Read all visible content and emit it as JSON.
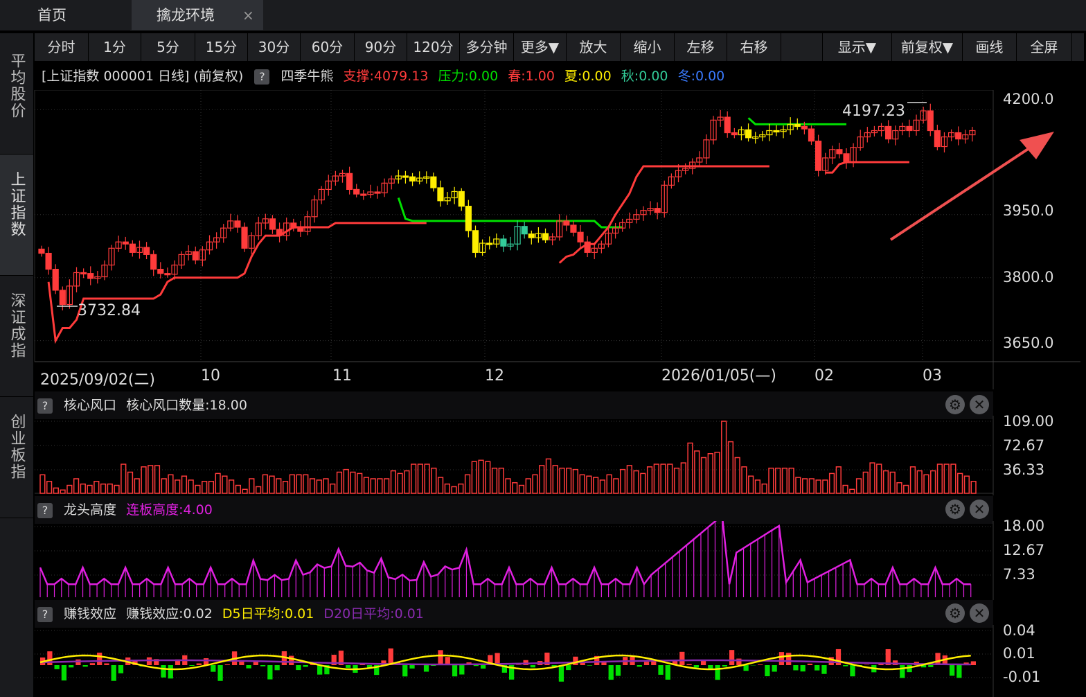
{
  "tabs": {
    "home": "首页",
    "active": "擒龙环境",
    "close": "×"
  },
  "sidebar": [
    "平均股价",
    "上证指数",
    "深证成指",
    "创业板指"
  ],
  "toolbar": [
    "分时",
    "1分",
    "5分",
    "15分",
    "30分",
    "60分",
    "90分",
    "120分",
    "多分钟",
    "更多▼",
    "放大",
    "缩小",
    "左移",
    "右移",
    "",
    "显示▼",
    "前复权▼",
    "画线",
    "全屏"
  ],
  "info": {
    "title": "[上证指数 000001 日线] (前复权)",
    "help": "?",
    "indicator": "四季牛熊",
    "support_label": "支撑:4079.13",
    "pressure_label": "压力:0.00",
    "spring_label": "春:1.00",
    "summer_label": "夏:0.00",
    "autumn_label": "秋:0.00",
    "winter_label": "冬:0.00"
  },
  "main_chart": {
    "high_label": "4197.23",
    "low_label": "3732.84",
    "y_ticks": [
      "4200.0",
      "3950.0",
      "3800.0",
      "3650.0"
    ],
    "x_ticks": [
      "2025/09/02(二)",
      "10",
      "11",
      "12",
      "2026/01/05(—)",
      "02",
      "03"
    ]
  },
  "panel1": {
    "help": "?",
    "name": "核心风口",
    "value_label": "核心风口数量:18.00",
    "y_ticks": [
      "109.00",
      "72.67",
      "36.33"
    ]
  },
  "panel2": {
    "help": "?",
    "name": "龙头高度",
    "value_label": "连板高度:4.00",
    "y_ticks": [
      "18.00",
      "12.67",
      "7.33"
    ]
  },
  "panel3": {
    "help": "?",
    "name": "赚钱效应",
    "value_label": "赚钱效应:0.02",
    "d5_label": "D5日平均:0.01",
    "d20_label": "D20日平均:0.01",
    "y_ticks": [
      "0.04",
      "0.01",
      "-0.01"
    ]
  },
  "colors": {
    "up": "#ff3b3b",
    "yellow": "#ffee00",
    "green": "#00e000",
    "teal": "#33cc99",
    "magenta": "#e020e0",
    "purple": "#8a2bb0",
    "arrow": "#f05050"
  },
  "chart_data": {
    "type": "candlestick",
    "title": "[上证指数 000001 日线] (前复权)",
    "x_ticks": [
      "2025/09/02(二)",
      "10",
      "11",
      "12",
      "2026/01/05(—)",
      "02",
      "03"
    ],
    "ylim": [
      3600,
      4230
    ],
    "y_ticks": [
      4200.0,
      3950.0,
      3800.0,
      3650.0
    ],
    "close": [
      3858,
      3820,
      3770,
      3736,
      3780,
      3812,
      3810,
      3798,
      3802,
      3830,
      3870,
      3885,
      3880,
      3860,
      3872,
      3855,
      3820,
      3810,
      3808,
      3830,
      3855,
      3862,
      3842,
      3866,
      3885,
      3895,
      3918,
      3935,
      3920,
      3870,
      3900,
      3930,
      3940,
      3915,
      3900,
      3930,
      3918,
      3910,
      3945,
      3985,
      4010,
      4030,
      4042,
      4048,
      4010,
      3999,
      3998,
      4004,
      4002,
      4025,
      4035,
      4042,
      4040,
      4030,
      4037,
      4040,
      4014,
      3983,
      3990,
      4005,
      3970,
      3912,
      3860,
      3882,
      3880,
      3892,
      3875,
      3880,
      3922,
      3904,
      3895,
      3905,
      3890,
      3897,
      3935,
      3925,
      3908,
      3885,
      3860,
      3870,
      3880,
      3906,
      3918,
      3931,
      3939,
      3950,
      3960,
      3965,
      3955,
      4020,
      4040,
      4055,
      4060,
      4075,
      4085,
      4128,
      4175,
      4182,
      4145,
      4140,
      4152,
      4133,
      4135,
      4140,
      4150,
      4148,
      4152,
      4165,
      4160,
      4154,
      4125,
      4055,
      4085,
      4105,
      4095,
      4075,
      4110,
      4135,
      4145,
      4150,
      4160,
      4130,
      4150,
      4160,
      4150,
      4175,
      4197,
      4150,
      4112,
      4135,
      4145,
      4130,
      4140,
      4150
    ],
    "support_line": [
      3790,
      3650,
      3680,
      3680,
      3700,
      3750,
      3750,
      3750,
      3750,
      3750,
      3750,
      3750,
      3750,
      3750,
      3750,
      3750,
      3760,
      3790,
      3800,
      3800,
      3800,
      3800,
      3800,
      3800,
      3800,
      3800,
      3800,
      3800,
      3810,
      3850,
      3880,
      3900,
      3900,
      3900,
      3910,
      3920,
      3920,
      3920,
      3920,
      3920,
      3920,
      3930,
      3930,
      3930,
      3930,
      3930,
      3930,
      3930,
      3930,
      3930,
      3930,
      3930,
      3930,
      3930,
      3930
    ],
    "pressure_line_1": [
      3990,
      3940,
      3935,
      3935,
      3935,
      3935,
      3935,
      3935,
      3935,
      3935,
      3935,
      3935,
      3935,
      3935,
      3935,
      3935,
      3935,
      3935,
      3935,
      3935,
      3935,
      3935,
      3935,
      3935,
      3935,
      3935,
      3935,
      3935,
      3935,
      3920,
      3920,
      3920,
      3920
    ],
    "support_line_2": [
      3835,
      3850,
      3855,
      3870,
      3880,
      3880,
      3900,
      3920,
      3950,
      3975,
      4000,
      4040,
      4065,
      4065,
      4065,
      4065,
      4065,
      4065,
      4065,
      4065,
      4065,
      4065,
      4065,
      4065,
      4065,
      4065,
      4065,
      4065,
      4065,
      4065,
      4065
    ],
    "pressure_line_2": [
      4180,
      4165,
      4165,
      4165,
      4165,
      4165,
      4165,
      4165,
      4165,
      4165,
      4165,
      4165,
      4165,
      4165,
      4165
    ],
    "support_line_3": [
      4050,
      4050,
      4070,
      4075,
      4075,
      4075,
      4075,
      4075,
      4075,
      4075,
      4075,
      4075,
      4075
    ],
    "panel1_values": [
      28,
      18,
      8,
      5,
      12,
      22,
      14,
      12,
      18,
      14,
      14,
      12,
      44,
      32,
      22,
      40,
      42,
      42,
      22,
      28,
      20,
      26,
      20,
      12,
      18,
      18,
      30,
      26,
      20,
      12,
      6,
      22,
      10,
      28,
      26,
      22,
      18,
      28,
      28,
      28,
      22,
      20,
      22,
      14,
      32,
      36,
      32,
      30,
      24,
      22,
      22,
      22,
      34,
      30,
      34,
      44,
      44,
      44,
      38,
      24,
      14,
      10,
      14,
      28,
      48,
      50,
      48,
      38,
      38,
      22,
      16,
      12,
      22,
      28,
      42,
      52,
      42,
      38,
      38,
      36,
      28,
      26,
      24,
      20,
      28,
      22,
      36,
      42,
      34,
      30,
      40,
      44,
      44,
      44,
      38,
      46,
      76,
      64,
      54,
      60,
      62,
      109,
      78,
      54,
      40,
      26,
      20,
      14,
      38,
      38,
      38,
      38,
      24,
      22,
      22,
      20,
      20,
      30,
      40,
      12,
      6,
      22,
      32,
      46,
      44,
      34,
      32,
      16,
      12,
      40,
      34,
      28,
      34,
      44,
      44,
      44,
      30,
      26,
      18
    ]
  }
}
